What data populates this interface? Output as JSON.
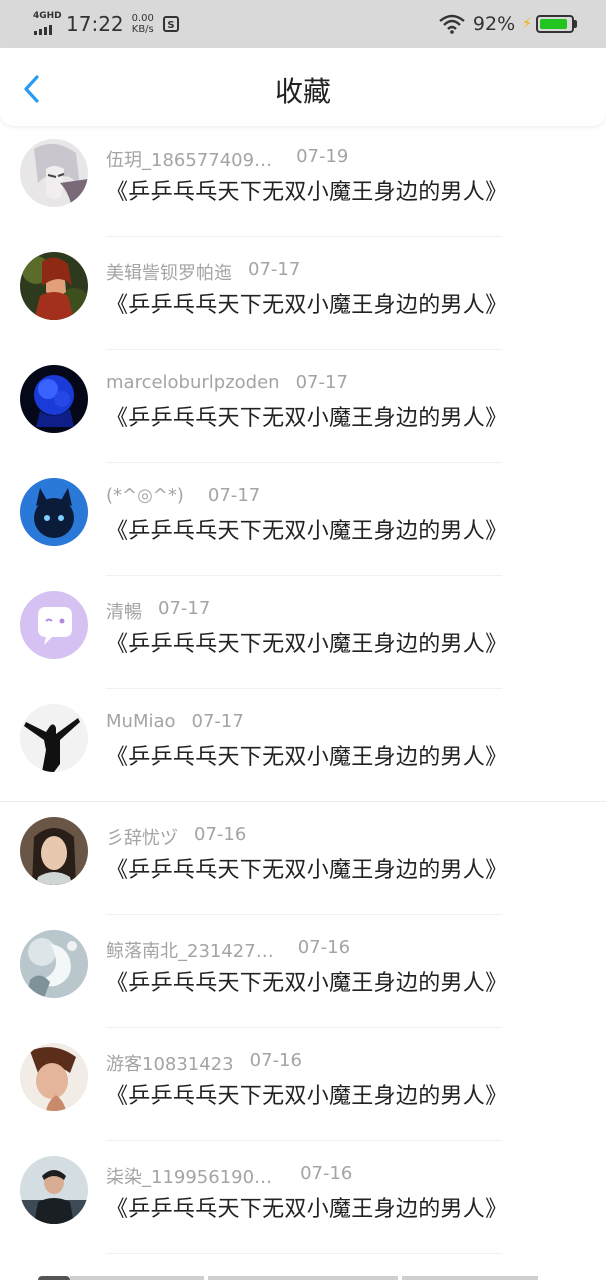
{
  "status_bar": {
    "network": "4GHD",
    "time": "17:22",
    "speed_value": "0.00",
    "speed_unit": "KB/s",
    "battery_percent": "92%",
    "battery_level": 0.92,
    "wifi_icon": "wifi-icon",
    "charging_icon": "bolt-icon"
  },
  "header": {
    "title": "收藏",
    "back_icon": "chevron-left-icon",
    "accent": "#2a9bf0"
  },
  "items": [
    {
      "user": "伍玥_186577409…",
      "date": "07-19",
      "title": "《乒乒乓乓天下无双小魔王身边的男人》"
    },
    {
      "user": "美辑訾钡罗帕迤",
      "date": "07-17",
      "title": "《乒乒乓乓天下无双小魔王身边的男人》"
    },
    {
      "user": "marceloburlpzoden",
      "date": "07-17",
      "title": "《乒乒乓乓天下无双小魔王身边的男人》"
    },
    {
      "user": "(*^◎^*)",
      "date": "07-17",
      "title": "《乒乒乓乓天下无双小魔王身边的男人》"
    },
    {
      "user": "清暢",
      "date": "07-17",
      "title": "《乒乒乓乓天下无双小魔王身边的男人》"
    },
    {
      "user": "MuMiao",
      "date": "07-17",
      "title": "《乒乒乓乓天下无双小魔王身边的男人》"
    },
    {
      "user": "彡辞忧ヅ",
      "date": "07-16",
      "title": "《乒乒乓乓天下无双小魔王身边的男人》"
    },
    {
      "user": "鲸落南北_231427…",
      "date": "07-16",
      "title": "《乒乒乓乓天下无双小魔王身边的男人》"
    },
    {
      "user": "游客10831423",
      "date": "07-16",
      "title": "《乒乒乓乓天下无双小魔王身边的男人》"
    },
    {
      "user": "柒染_119956190…",
      "date": "07-16",
      "title": "《乒乒乓乓天下无双小魔王身边的男人》"
    }
  ]
}
